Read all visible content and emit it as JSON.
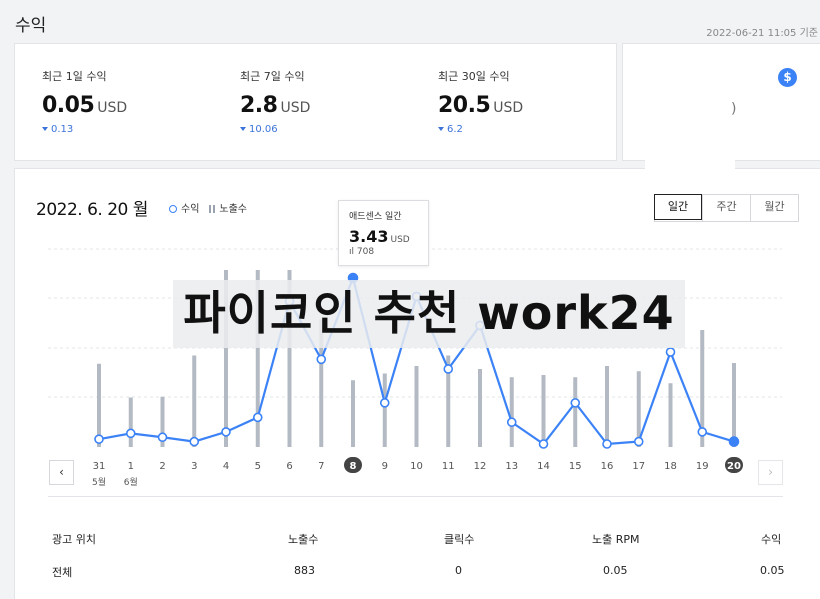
{
  "header": {
    "title": "수익",
    "timestamp": "2022-06-21 11:05 기준"
  },
  "summary": [
    {
      "label": "최근 1일 수익",
      "value": "0.05",
      "unit": "USD",
      "change": "0.13"
    },
    {
      "label": "최근 7일 수익",
      "value": "2.8",
      "unit": "USD",
      "change": "10.06"
    },
    {
      "label": "최근 30일 수익",
      "value": "20.5",
      "unit": "USD",
      "change": "6.2"
    }
  ],
  "side_card": {
    "icon": "dollar-icon",
    "value_fragment": ")"
  },
  "chart_header": {
    "date": "2022. 6. 20 월",
    "legend_revenue": "수익",
    "legend_impressions": "노출수"
  },
  "period_tabs": [
    "일간",
    "주간",
    "월간"
  ],
  "tooltip": {
    "title": "애드센스 일간",
    "value": "3.43",
    "unit": "USD",
    "impressions": "708"
  },
  "chart_data": {
    "type": "line",
    "categories": [
      "31",
      "1",
      "2",
      "3",
      "4",
      "5",
      "6",
      "7",
      "8",
      "9",
      "10",
      "11",
      "12",
      "13",
      "14",
      "15",
      "16",
      "17",
      "18",
      "19",
      "20"
    ],
    "month_labels": {
      "31": "5월",
      "1": "6월"
    },
    "series": [
      {
        "name": "수익",
        "values": [
          0.1,
          0.22,
          0.14,
          0.05,
          0.25,
          0.55,
          2.95,
          1.75,
          3.43,
          0.85,
          3.05,
          1.55,
          2.45,
          0.45,
          0.0,
          0.85,
          0.0,
          0.05,
          1.9,
          0.25,
          0.05
        ]
      },
      {
        "name": "노출수",
        "values": [
          555,
          330,
          335,
          610,
          1180,
          1180,
          1180,
          850,
          445,
          490,
          540,
          610,
          520,
          465,
          480,
          465,
          540,
          505,
          425,
          780,
          560
        ]
      }
    ],
    "selected_index": 8,
    "today_index": 20,
    "colors": {
      "line": "#3b82f6",
      "bar": "#b3bac3",
      "grid": "#e2e4e8"
    }
  },
  "table": {
    "headers": [
      "광고 위치",
      "노출수",
      "클릭수",
      "노출 RPM",
      "수익"
    ],
    "rows": [
      [
        "전체",
        "883",
        "0",
        "0.05",
        "0.05"
      ]
    ]
  },
  "overlay_text": "파이코인 추천 work24"
}
